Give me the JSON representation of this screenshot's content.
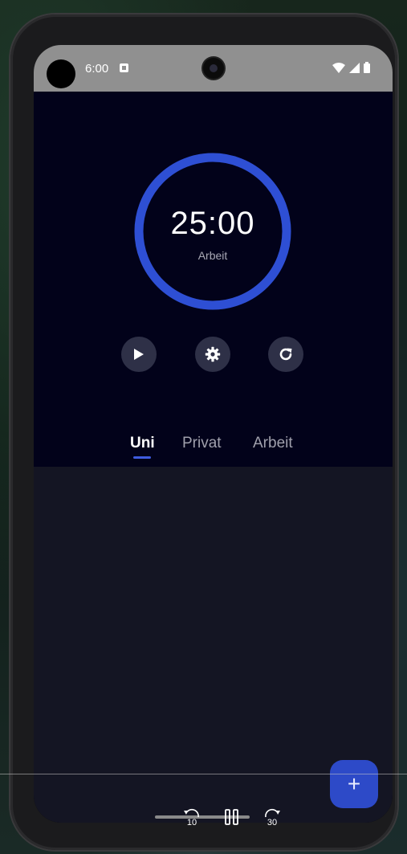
{
  "status_bar": {
    "time": "6:00",
    "icons": [
      "notification-icon",
      "wifi-icon",
      "signal-icon",
      "battery-icon"
    ]
  },
  "timer": {
    "time": "25:00",
    "mode": "Arbeit",
    "progress": 1.0,
    "ring_color": "#2e4fd4"
  },
  "controls": {
    "play_icon": "play-icon",
    "settings_icon": "gear-icon",
    "reset_icon": "refresh-icon"
  },
  "tabs": [
    {
      "label": "Uni",
      "active": true
    },
    {
      "label": "Privat",
      "active": false
    },
    {
      "label": "Arbeit",
      "active": false
    }
  ],
  "fab": {
    "icon": "plus-icon",
    "label": "+"
  },
  "media": {
    "rewind_seconds": "10",
    "forward_seconds": "30"
  },
  "colors": {
    "accent": "#2e4fd4",
    "top_background": "#02021a",
    "task_background": "#141523",
    "control_background": "#2e3047"
  }
}
